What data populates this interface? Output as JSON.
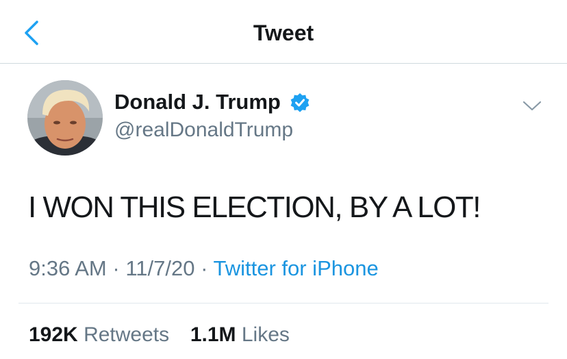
{
  "header": {
    "title": "Tweet",
    "back_icon": "chevron-left-icon"
  },
  "author": {
    "display_name": "Donald J. Trump",
    "handle": "@realDonaldTrump",
    "verified_icon": "verified-badge-icon",
    "avatar": "profile-photo"
  },
  "tweet": {
    "text": "I WON THIS ELECTION, BY A LOT!",
    "time": "9:36 AM",
    "separator": "·",
    "date": "11/7/20",
    "source": "Twitter for iPhone",
    "more_icon": "chevron-down-icon"
  },
  "stats": {
    "retweets_count": "192K",
    "retweets_label": "Retweets",
    "likes_count": "1.1M",
    "likes_label": "Likes"
  },
  "colors": {
    "text": "#14171a",
    "secondary": "#657786",
    "accent": "#1b95e0",
    "verified": "#1da1f2",
    "divider": "#e1e8ed"
  }
}
